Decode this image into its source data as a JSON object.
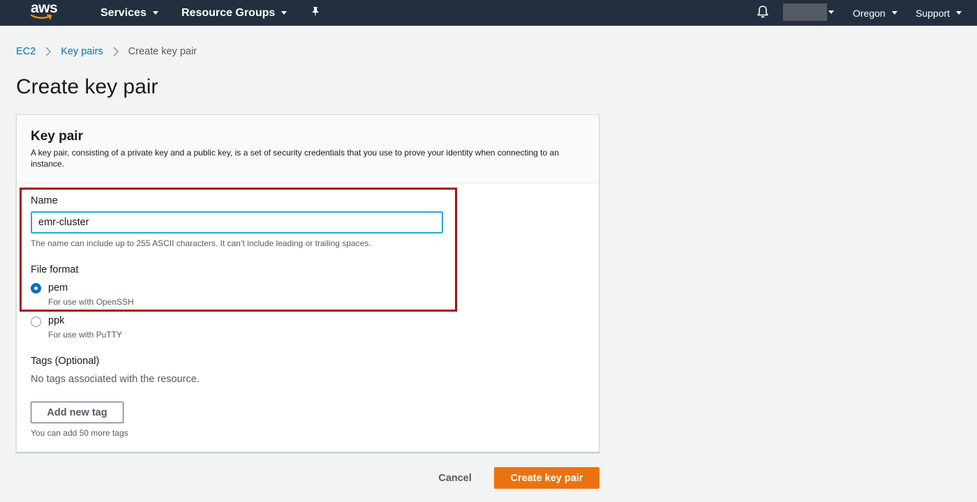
{
  "nav": {
    "services": "Services",
    "resource_groups": "Resource Groups",
    "region": "Oregon",
    "support": "Support"
  },
  "breadcrumb": {
    "ec2": "EC2",
    "key_pairs": "Key pairs",
    "current": "Create key pair"
  },
  "page_title": "Create key pair",
  "panel": {
    "title": "Key pair",
    "description": "A key pair, consisting of a private key and a public key, is a set of security credentials that you use to prove your identity when connecting to an instance."
  },
  "name_field": {
    "label": "Name",
    "value": "emr-cluster",
    "hint": "The name can include up to 255 ASCII characters. It can’t include leading or trailing spaces."
  },
  "file_format": {
    "label": "File format",
    "options": [
      {
        "label": "pem",
        "sub": "For use with OpenSSH",
        "checked": true
      },
      {
        "label": "ppk",
        "sub": "For use with PuTTY",
        "checked": false
      }
    ]
  },
  "tags": {
    "label": "Tags (Optional)",
    "empty_text": "No tags associated with the resource.",
    "add_button": "Add new tag",
    "remaining_hint": "You can add 50 more tags"
  },
  "actions": {
    "cancel": "Cancel",
    "create": "Create key pair"
  },
  "colors": {
    "nav_bg": "#232f3e",
    "link": "#0073bb",
    "primary_button": "#ec7211",
    "highlight_border": "#a50e16"
  }
}
